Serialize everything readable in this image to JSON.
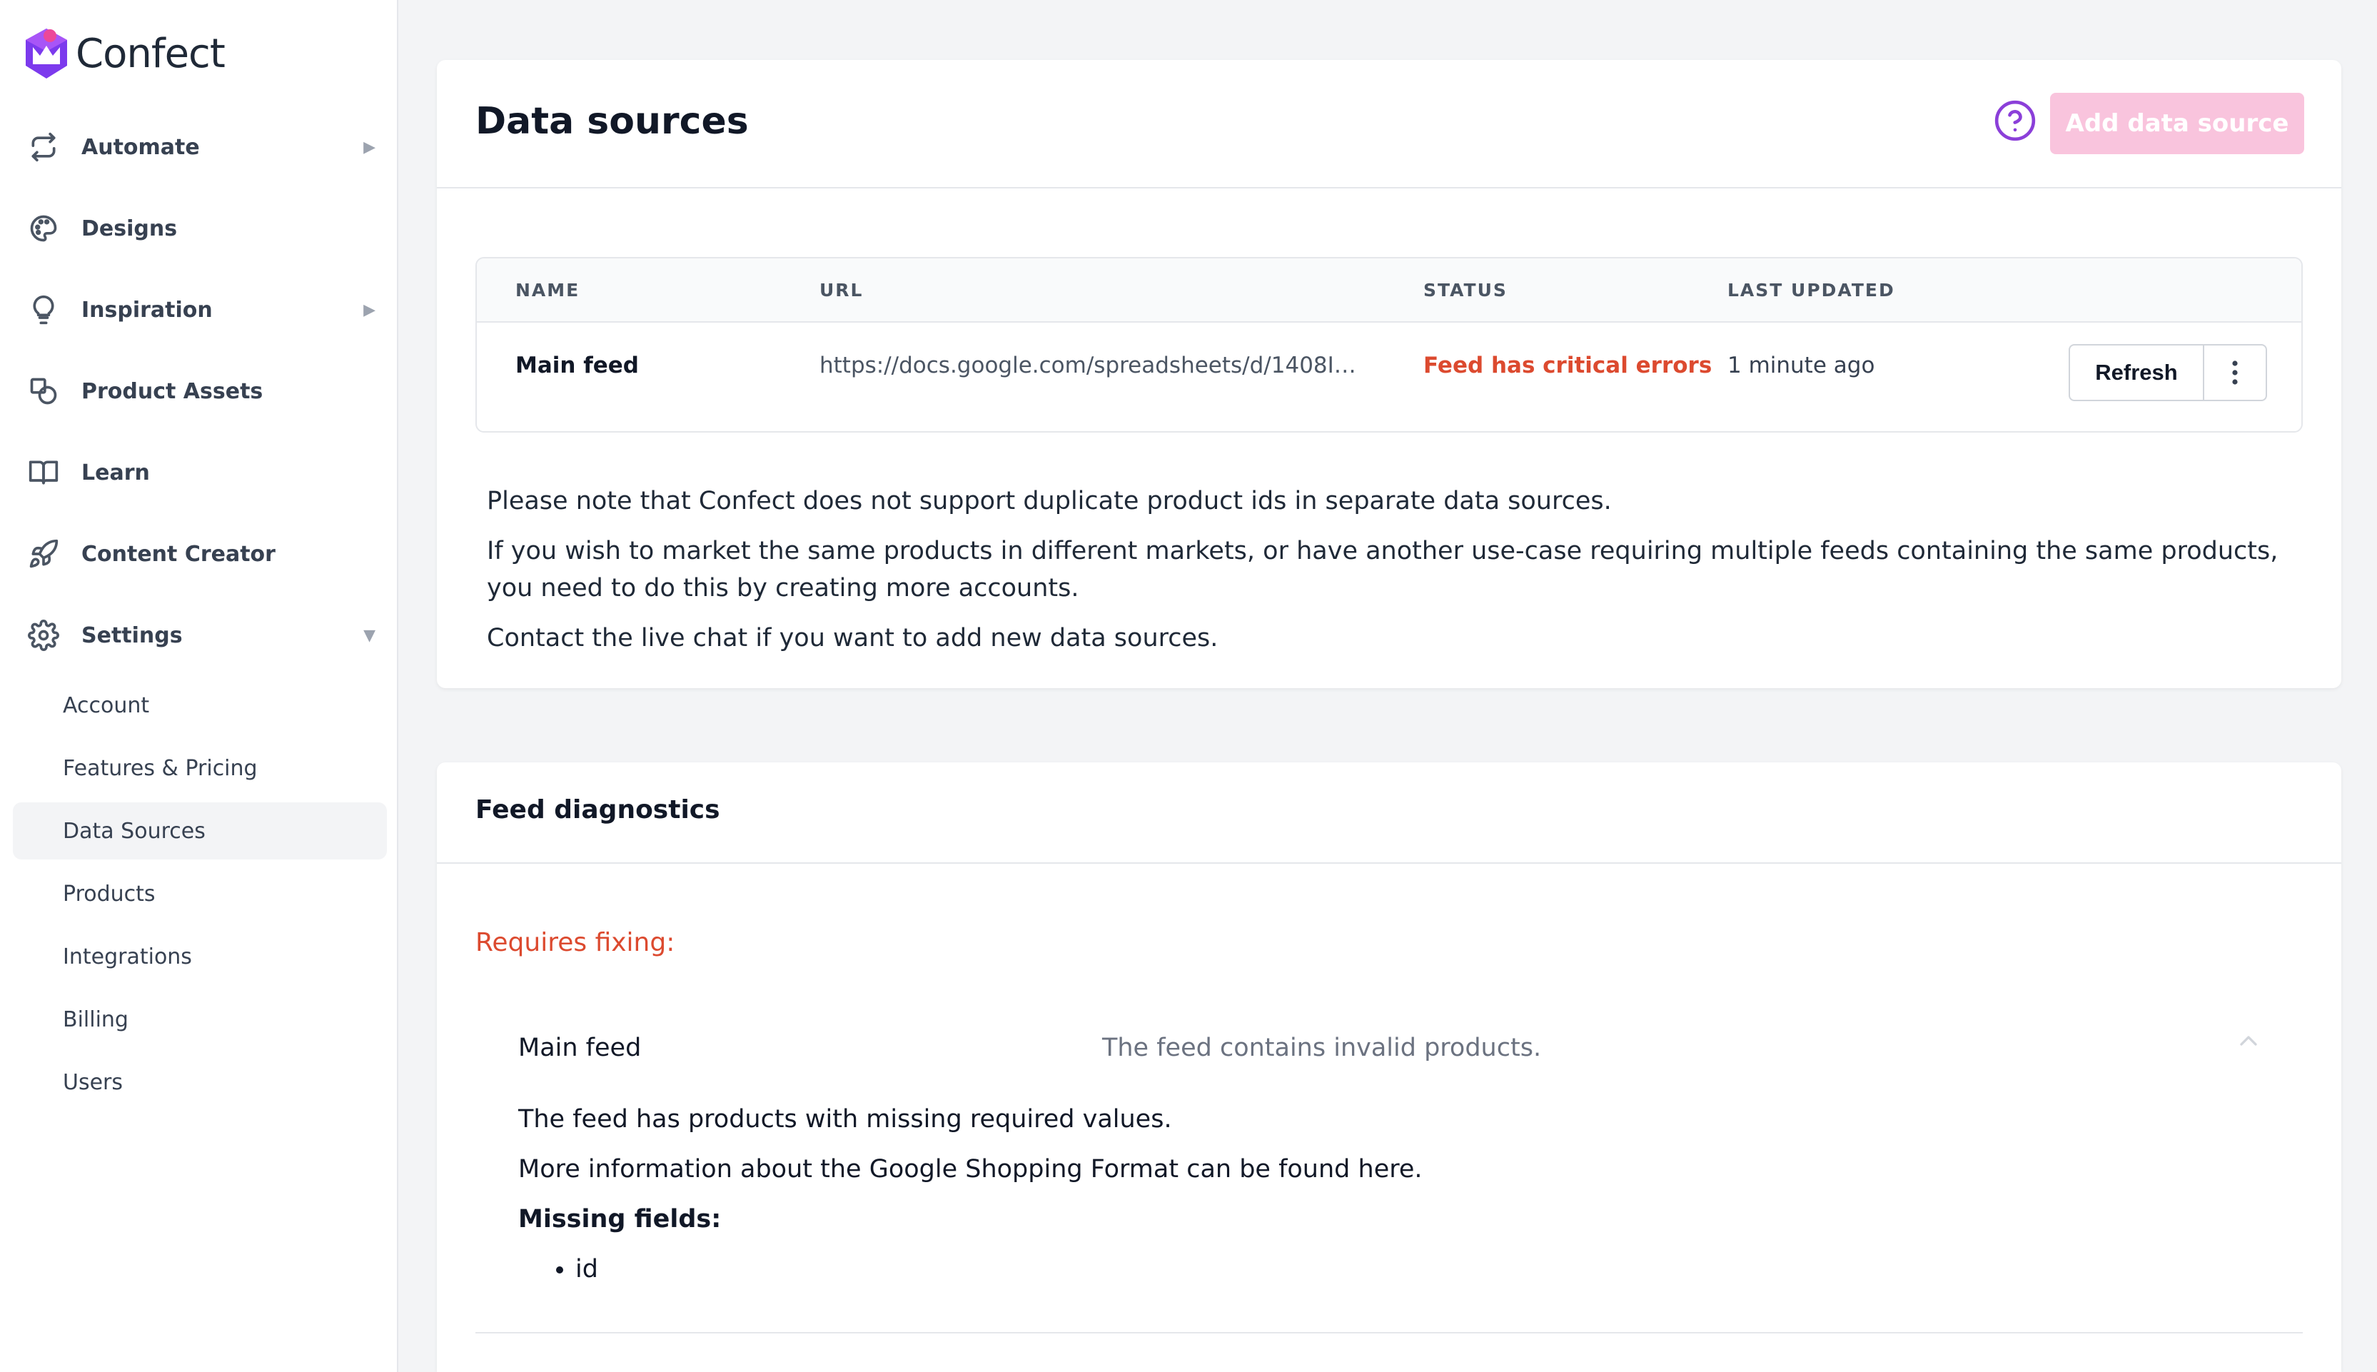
{
  "app": {
    "name": "Confect",
    "brand_color": "#8b3fd9",
    "accent_pink": "#f9c4dd",
    "error_color": "#dc4a2f"
  },
  "sidebar": {
    "items": [
      {
        "label": "Automate",
        "icon": "repeat-icon",
        "has_arrow": true,
        "arrow": "▶"
      },
      {
        "label": "Designs",
        "icon": "palette-icon",
        "has_arrow": false
      },
      {
        "label": "Inspiration",
        "icon": "lightbulb-icon",
        "has_arrow": true,
        "arrow": "▶"
      },
      {
        "label": "Product Assets",
        "icon": "shapes-icon",
        "has_arrow": false
      },
      {
        "label": "Learn",
        "icon": "book-icon",
        "has_arrow": false
      },
      {
        "label": "Content Creator",
        "icon": "rocket-icon",
        "has_arrow": false
      },
      {
        "label": "Settings",
        "icon": "gear-icon",
        "has_arrow": true,
        "arrow": "▼",
        "expanded": true
      }
    ],
    "settings_sub": [
      {
        "label": "Account"
      },
      {
        "label": "Features & Pricing"
      },
      {
        "label": "Data Sources",
        "active": true
      },
      {
        "label": "Products"
      },
      {
        "label": "Integrations"
      },
      {
        "label": "Billing"
      },
      {
        "label": "Users"
      }
    ]
  },
  "data_sources": {
    "title": "Data sources",
    "help_icon": "question-circle-icon",
    "add_button": "Add data source",
    "table": {
      "headers": [
        "NAME",
        "URL",
        "STATUS",
        "LAST UPDATED"
      ],
      "rows": [
        {
          "name": "Main feed",
          "url": "https://docs.google.com/spreadsheets/d/1408I…",
          "status": "Feed has critical errors",
          "last_updated": "1 minute ago",
          "refresh_label": "Refresh",
          "menu_icon": "kebab-menu-icon"
        }
      ]
    },
    "notes": [
      "Please note that Confect does not support duplicate product ids in separate data sources.",
      "If you wish to market the same products in different markets, or have another use-case requiring multiple feeds containing the same products, you need to do this by creating more accounts.",
      "Contact the live chat if you want to add new data sources."
    ]
  },
  "feed_diagnostics": {
    "title": "Feed diagnostics",
    "requires_fixing": "Requires fixing:",
    "issue": {
      "feed": "Main feed",
      "summary": "The feed contains invalid products.",
      "detail_1": "The feed has products with missing required values.",
      "detail_2": "More information about the Google Shopping Format can be found here.",
      "missing_label": "Missing fields:",
      "missing_fields": [
        "id"
      ]
    }
  }
}
